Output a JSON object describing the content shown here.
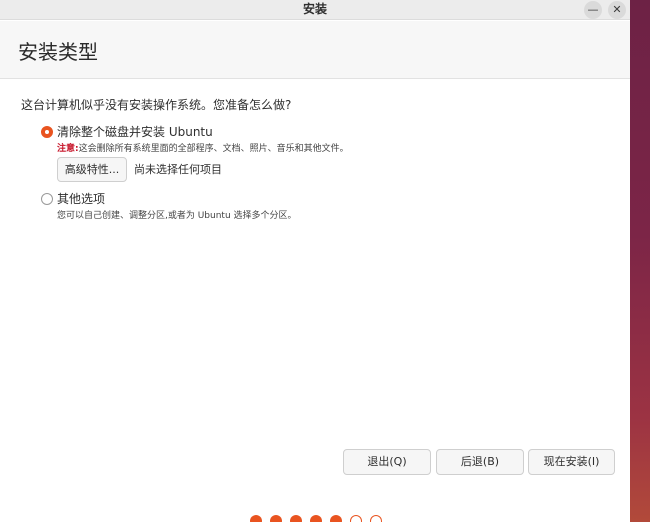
{
  "window": {
    "title": "安装",
    "minimize_glyph": "—",
    "close_glyph": "✕"
  },
  "page": {
    "title": "安装类型",
    "question": "这台计算机似乎没有安装操作系统。您准备怎么做?"
  },
  "options": [
    {
      "label": "清除整个磁盘并安装 Ubuntu",
      "selected": true,
      "note_prefix": "注意:",
      "note": "这会删除所有系统里面的全部程序、文档、照片、音乐和其他文件。",
      "advanced_button": "高级特性...",
      "advanced_status": "尚未选择任何项目"
    },
    {
      "label": "其他选项",
      "selected": false,
      "description": "您可以自己创建、调整分区,或者为 Ubuntu 选择多个分区。"
    }
  ],
  "buttons": {
    "quit": "退出(Q)",
    "back": "后退(B)",
    "install": "现在安装(I)"
  },
  "progress": {
    "steps": [
      true,
      true,
      true,
      true,
      true,
      false,
      false
    ]
  },
  "colors": {
    "accent": "#e95420",
    "warning": "#c7162b",
    "desktop": "#6b1f45"
  }
}
